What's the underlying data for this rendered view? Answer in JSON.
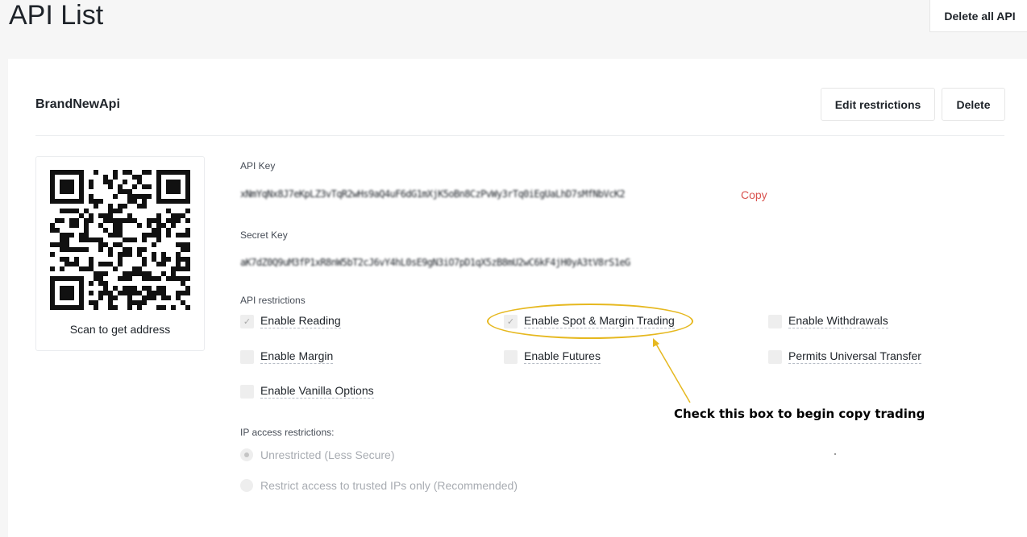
{
  "page": {
    "title": "API List",
    "delete_all_label": "Delete all API"
  },
  "api": {
    "name": "BrandNewApi",
    "edit_label": "Edit restrictions",
    "delete_label": "Delete",
    "qr_label": "Scan to get address",
    "api_key_label": "API Key",
    "api_key_value": "xNmYqNx8J7eKpLZ3vTqR2wHs9aQ4uF6dG1mXjK5oBn8CzPvWy3rTq0iEgUaLhD7sMfNbVcK2",
    "copy_label": "Copy",
    "secret_key_label": "Secret Key",
    "secret_key_value": "aK7dZ0Q9uM3fP1xR8nW5bT2cJ6vY4hL0sE9gN3iO7pD1qX5zB8mU2wC6kF4jH0yA3tV8rS1eG"
  },
  "restrictions": {
    "label": "API restrictions",
    "items": [
      {
        "label": "Enable Reading",
        "checked": true
      },
      {
        "label": "Enable Spot & Margin Trading",
        "checked": true
      },
      {
        "label": "Enable Withdrawals",
        "checked": false
      },
      {
        "label": "Enable Margin",
        "checked": false
      },
      {
        "label": "Enable Futures",
        "checked": false
      },
      {
        "label": "Permits Universal Transfer",
        "checked": false
      },
      {
        "label": "Enable Vanilla Options",
        "checked": false
      }
    ],
    "checkmark": "✓"
  },
  "ip_access": {
    "label": "IP access restrictions:",
    "options": [
      {
        "label": "Unrestricted (Less Secure)",
        "selected": true
      },
      {
        "label": "Restrict access to trusted IPs only (Recommended)",
        "selected": false
      }
    ]
  },
  "annotation": {
    "text": "Check this box to begin copy trading",
    "color": "#e6b81f"
  }
}
